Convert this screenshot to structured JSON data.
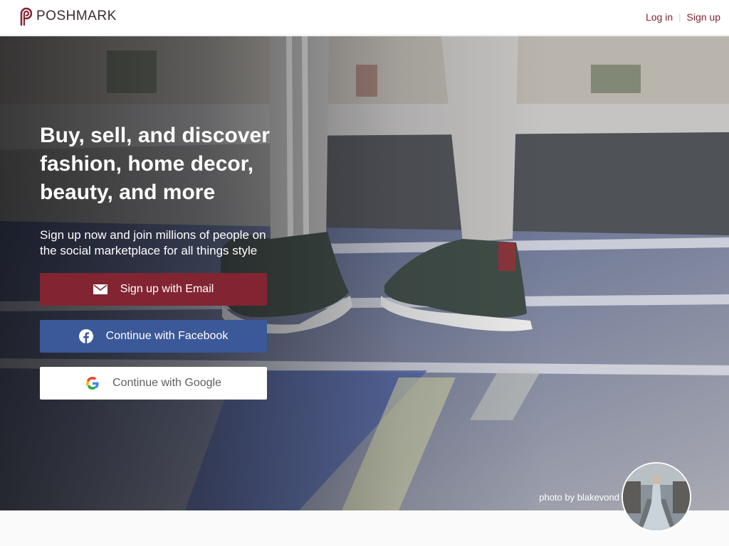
{
  "brand": {
    "name": "POSHMARK",
    "logo_icon": "poshmark-logo-icon",
    "accent_color": "#822432"
  },
  "header": {
    "login_label": "Log in",
    "signup_label": "Sign up"
  },
  "hero": {
    "headline": "Buy, sell, and discover fashion, home decor, beauty, and more",
    "subheadline": "Sign up now and join millions of people on the social marketplace for all things style",
    "buttons": {
      "email": {
        "label": "Sign up with Email",
        "icon": "envelope-icon",
        "color": "#822432"
      },
      "facebook": {
        "label": "Continue with Facebook",
        "icon": "facebook-icon",
        "color": "#3b5998"
      },
      "google": {
        "label": "Continue with Google",
        "icon": "google-icon",
        "color": "#ffffff"
      }
    },
    "photo_credit": "photo by blakevond"
  }
}
